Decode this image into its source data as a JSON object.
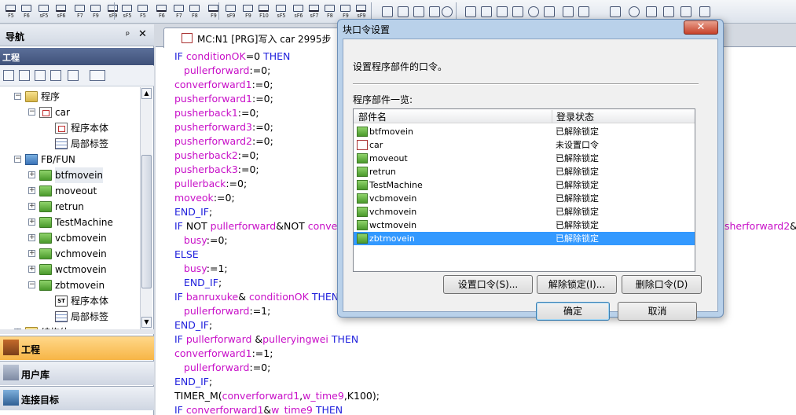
{
  "toolbar": {
    "keys": [
      "F5",
      "F6",
      "sF5",
      "sF6",
      "F7",
      "F9",
      "sF9",
      "sF5",
      "F5",
      "F6",
      "F7",
      "F8",
      "F9",
      "sF9",
      "F9",
      "F10",
      "sF5",
      "sF6",
      "sF7",
      "F8",
      "F9",
      "sF9"
    ]
  },
  "nav": {
    "title": "导航",
    "pin": "ᵖ",
    "close": "✕",
    "project_header": "工程",
    "tree": [
      {
        "label": "程序",
        "indent": 0,
        "expander": "−",
        "icon": "folder"
      },
      {
        "label": "car",
        "indent": 1,
        "expander": "−",
        "icon": "prog"
      },
      {
        "label": "程序本体",
        "indent": 2,
        "expander": "",
        "icon": "prog"
      },
      {
        "label": "局部标签",
        "indent": 2,
        "expander": "",
        "icon": "grid"
      },
      {
        "label": "FB/FUN",
        "indent": 0,
        "expander": "−",
        "icon": "fb"
      },
      {
        "label": "btfmovein",
        "indent": 1,
        "expander": "+",
        "icon": "folderg"
      },
      {
        "label": "moveout",
        "indent": 1,
        "expander": "+",
        "icon": "folderg"
      },
      {
        "label": "retrun",
        "indent": 1,
        "expander": "+",
        "icon": "folderg"
      },
      {
        "label": "TestMachine",
        "indent": 1,
        "expander": "+",
        "icon": "folderg"
      },
      {
        "label": "vcbmovein",
        "indent": 1,
        "expander": "+",
        "icon": "folderg"
      },
      {
        "label": "vchmovein",
        "indent": 1,
        "expander": "+",
        "icon": "folderg"
      },
      {
        "label": "wctmovein",
        "indent": 1,
        "expander": "+",
        "icon": "folderg"
      },
      {
        "label": "zbtmovein",
        "indent": 1,
        "expander": "−",
        "icon": "folderg"
      },
      {
        "label": "程序本体",
        "indent": 2,
        "expander": "",
        "icon": "st"
      },
      {
        "label": "局部标签",
        "indent": 2,
        "expander": "",
        "icon": "grid"
      },
      {
        "label": "结构体",
        "indent": 0,
        "expander": "+",
        "icon": "folder"
      }
    ],
    "sections": {
      "project": "工程",
      "library": "用户库",
      "connection": "连接目标"
    }
  },
  "editor": {
    "tab_label": "MC:N1 [PRG]写入 car 2995步",
    "lines": [
      [
        [
          "k",
          "IF "
        ],
        [
          "v",
          "conditionOK"
        ],
        [
          "p",
          "=0 "
        ],
        [
          "k",
          "THEN"
        ]
      ],
      [
        [
          "p",
          "   "
        ],
        [
          "v",
          "pullerforward"
        ],
        [
          "p",
          ":=0;"
        ]
      ],
      [
        [
          "v",
          "converforward1"
        ],
        [
          "p",
          ":=0;"
        ]
      ],
      [
        [
          "v",
          "pusherforward1"
        ],
        [
          "p",
          ":=0;"
        ]
      ],
      [
        [
          "v",
          "pusherback1"
        ],
        [
          "p",
          ":=0;"
        ]
      ],
      [
        [
          "v",
          "pusherforward3"
        ],
        [
          "p",
          ":=0;"
        ]
      ],
      [
        [
          "v",
          "pusherforward2"
        ],
        [
          "p",
          ":=0;"
        ]
      ],
      [
        [
          "v",
          "pusherback2"
        ],
        [
          "p",
          ":=0;"
        ]
      ],
      [
        [
          "v",
          "pusherback3"
        ],
        [
          "p",
          ":=0;"
        ]
      ],
      [
        [
          "v",
          "pullerback"
        ],
        [
          "p",
          ":=0;"
        ]
      ],
      [
        [
          "v",
          "moveok"
        ],
        [
          "p",
          ":=0;"
        ]
      ],
      [
        [
          "k",
          "END_IF"
        ],
        [
          "p",
          ";"
        ]
      ],
      [
        [
          "k",
          "IF "
        ],
        [
          "p",
          "NOT "
        ],
        [
          "v",
          "pullerforward"
        ],
        [
          "p",
          "&NOT "
        ],
        [
          "v",
          "conver"
        ]
      ],
      [
        [
          "p",
          "   "
        ],
        [
          "v",
          "busy"
        ],
        [
          "p",
          ":=0;"
        ]
      ],
      [
        [
          "k",
          "ELSE"
        ]
      ],
      [
        [
          "p",
          "   "
        ],
        [
          "v",
          "busy"
        ],
        [
          "p",
          ":=1;"
        ]
      ],
      [
        [
          "p",
          "   "
        ],
        [
          "k",
          "END_IF"
        ],
        [
          "p",
          ";"
        ]
      ],
      [
        [
          "k",
          "IF "
        ],
        [
          "v",
          "banruxuke"
        ],
        [
          "p",
          "& "
        ],
        [
          "v",
          "conditionOK"
        ],
        [
          "p",
          " "
        ],
        [
          "k",
          "THEN"
        ]
      ],
      [
        [
          "p",
          "   "
        ],
        [
          "v",
          "pullerforward"
        ],
        [
          "p",
          ":=1;"
        ]
      ],
      [
        [
          "k",
          "END_IF"
        ],
        [
          "p",
          ";"
        ]
      ],
      [
        [
          "k",
          "IF "
        ],
        [
          "v",
          "pullerforward"
        ],
        [
          "p",
          " &"
        ],
        [
          "v",
          "pulleryingwei"
        ],
        [
          "p",
          " "
        ],
        [
          "k",
          "THEN"
        ]
      ],
      [
        [
          "v",
          "converforward1"
        ],
        [
          "p",
          ":=1;"
        ]
      ],
      [
        [
          "p",
          "   "
        ],
        [
          "v",
          "pullerforward"
        ],
        [
          "p",
          ":=0;"
        ]
      ],
      [
        [
          "k",
          "END_IF"
        ],
        [
          "p",
          ";"
        ]
      ],
      [
        [
          "p",
          "TIMER_M("
        ],
        [
          "v",
          "converforward1"
        ],
        [
          "p",
          ","
        ],
        [
          "v",
          "w_time9"
        ],
        [
          "p",
          ",K100);"
        ]
      ],
      [
        [
          "k",
          "IF "
        ],
        [
          "v",
          "converforward1"
        ],
        [
          "p",
          "&"
        ],
        [
          "v",
          "w_time9"
        ],
        [
          "p",
          " "
        ],
        [
          "k",
          "THEN"
        ]
      ]
    ],
    "right_fragment": [
      [
        "v",
        "sherforward2"
      ],
      [
        "p",
        "&N"
      ]
    ]
  },
  "dialog": {
    "title": "块口令设置",
    "close": "✕",
    "description": "设置程序部件的口令。",
    "list_label": "程序部件一览:",
    "col_name": "部件名",
    "col_status": "登录状态",
    "rows": [
      {
        "name": "btfmovein",
        "status": "已解除锁定",
        "icon": "fb"
      },
      {
        "name": "car",
        "status": "未设置口令",
        "icon": "car"
      },
      {
        "name": "moveout",
        "status": "已解除锁定",
        "icon": "fb"
      },
      {
        "name": "retrun",
        "status": "已解除锁定",
        "icon": "fb"
      },
      {
        "name": "TestMachine",
        "status": "已解除锁定",
        "icon": "fb"
      },
      {
        "name": "vcbmovein",
        "status": "已解除锁定",
        "icon": "fb"
      },
      {
        "name": "vchmovein",
        "status": "已解除锁定",
        "icon": "fb"
      },
      {
        "name": "wctmovein",
        "status": "已解除锁定",
        "icon": "fb"
      },
      {
        "name": "zbtmovein",
        "status": "已解除锁定",
        "icon": "fb",
        "selected": true
      }
    ],
    "btn_set": "设置口令(S)...",
    "btn_unlock": "解除锁定(I)...",
    "btn_delete": "删除口令(D)",
    "btn_ok": "确定",
    "btn_cancel": "取消"
  }
}
